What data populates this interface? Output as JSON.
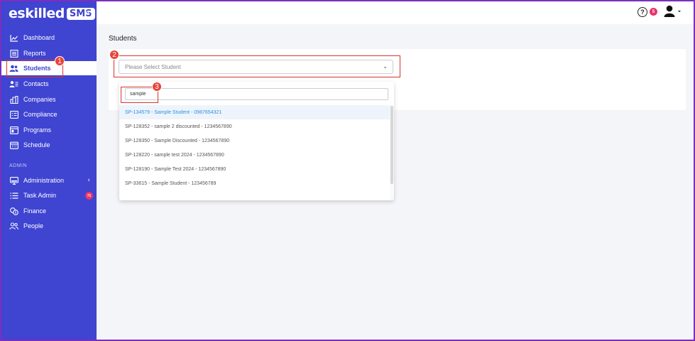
{
  "brand": {
    "name": "eskilled",
    "badge": "SMS"
  },
  "sidebar": {
    "items": [
      {
        "label": "Dashboard",
        "icon": "chart-line-icon"
      },
      {
        "label": "Reports",
        "icon": "report-icon"
      },
      {
        "label": "Students",
        "icon": "users-icon"
      },
      {
        "label": "Contacts",
        "icon": "contact-card-icon"
      },
      {
        "label": "Companies",
        "icon": "building-icon"
      },
      {
        "label": "Compliance",
        "icon": "checklist-icon"
      },
      {
        "label": "Programs",
        "icon": "window-icon"
      },
      {
        "label": "Schedule",
        "icon": "calendar-icon"
      }
    ],
    "section_label": "ADMIN",
    "admin_items": [
      {
        "label": "Administration",
        "icon": "monitor-icon"
      },
      {
        "label": "Task Admin",
        "icon": "list-icon",
        "badge": "71"
      },
      {
        "label": "Finance",
        "icon": "coins-icon"
      },
      {
        "label": "People",
        "icon": "people-icon"
      }
    ]
  },
  "topbar": {
    "notif_count": "5",
    "help_symbol": "?"
  },
  "main": {
    "page_title": "Students",
    "select_placeholder": "Please Select Student",
    "search_value": "sample",
    "options": [
      "SP-134579 - Sample Student - 0987654321",
      "SP-128352 - sample 2 discounted - 1234567890",
      "SP-128350 - Sample Discounted - 1234567890",
      "SP-128220 - sample test 2024 - 1234567890",
      "SP-128190 - Sample Test 2024 - 1234567890",
      "SP-33615 - Sample Student - 123456789"
    ]
  },
  "annotations": {
    "one": "1",
    "two": "2",
    "three": "3"
  },
  "colors": {
    "sidebar": "#3f44d1",
    "highlight": "#2a8fe0",
    "annotation": "#d9342b",
    "badge": "#e8336b"
  }
}
